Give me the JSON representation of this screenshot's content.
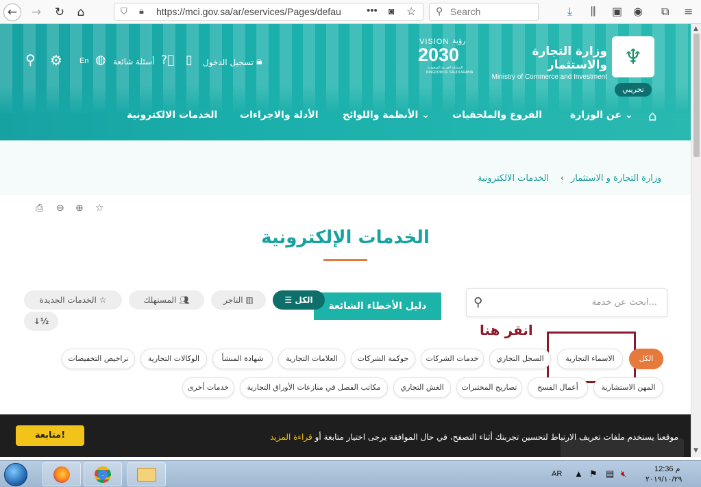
{
  "browser": {
    "url": "https://mci.gov.sa/ar/eservices/Pages/default",
    "search_placeholder": "Search",
    "icons": [
      "back-icon",
      "forward-icon",
      "reload-icon",
      "home-icon",
      "shield-icon",
      "lock-icon",
      "more-icon",
      "pocket-icon",
      "star-icon",
      "search-icon",
      "download-icon",
      "library-icon",
      "sidebar-icon",
      "account-icon",
      "extensions-icon",
      "menu-icon"
    ]
  },
  "header": {
    "ministry_ar": "وزارة التجارة والاستثمار",
    "ministry_en": "Ministry of Commerce and Investment",
    "demo_label": "تجريبي",
    "vision_label": "VISION",
    "vision_ar": "رؤية",
    "vision_year": "2030",
    "vision_sub_ar": "المملكة العربية السعودية",
    "vision_sub_en": "KINGDOM OF SAUDI ARABIA",
    "login_label": "تسجيل الدخول",
    "faq_label": "أسئلة شائعة",
    "lang_label": "En"
  },
  "main_nav": {
    "about": "عن الوزارة",
    "branches": "الفروع والملحقيات",
    "regulations": "الأنظمة واللوائح",
    "guides": "الأدلة والاجراءات",
    "eservices": "الخدمات الالكترونية"
  },
  "breadcrumb": {
    "home": "وزارة التجارة و الاستثمار",
    "current": "الخدمات الالكترونية"
  },
  "page": {
    "title": "الخدمات الإلكترونية",
    "search_placeholder": "ابحث عن خدمة...",
    "faq_button": "دليل الأخطاء الشائعة"
  },
  "audience": {
    "all": "الكل",
    "merchant": "التاجر",
    "consumer": "المستهلك",
    "new_services": "الخدمات الجديدة"
  },
  "categories_row1": [
    "الكل",
    "الاسماء التجارية",
    "السجل التجاري",
    "خدمات الشركات",
    "حوكمة الشركات",
    "العلامات التجارية",
    "شهادة المنشأ",
    "الوكالات التجارية",
    "تراخيص التخفيضات"
  ],
  "categories_row2": [
    "المهن الاستشارية",
    "أعمال الفسح",
    "تصاريح المختبرات",
    "الغش التجاري",
    "مكاتب الفصل في منازعات الأوراق التجارية",
    "خدمات أخرى"
  ],
  "annotation": "انقر هنا",
  "cookie": {
    "text": "موقعنا يستخدم ملفات تعريف الارتباط لتحسين تجربتك أثناء التصفح، في حال الموافقة يرجى اختيار متابعة أو",
    "link": "قراءة المزيد",
    "button": "متابعة!"
  },
  "taskbar": {
    "lang": "AR",
    "time": "12:36 م",
    "date": "٢٠١٩/١٠/٢٩"
  },
  "colors": {
    "teal": "#1bb0ac",
    "dark_teal": "#0e6e6a",
    "orange": "#e57a3c",
    "annotation": "#8a1a2a",
    "cookie_yellow": "#f2c41a"
  }
}
